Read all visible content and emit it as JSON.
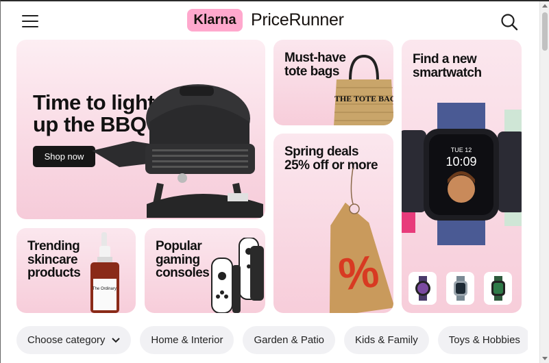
{
  "header": {
    "brand_klarna": "Klarna",
    "brand_name": "PriceRunner",
    "menu_icon": "hamburger-menu-icon",
    "search_icon": "search-icon"
  },
  "cards": {
    "bbq": {
      "title_line1": "Time to light",
      "title_line2": "up the BBQ",
      "button": "Shop now"
    },
    "tote": {
      "title_line1": "Must-have",
      "title_line2": "tote bags",
      "product_text": "THE TOTE BAG"
    },
    "watch": {
      "title_line1": "Find a new",
      "title_line2": "smartwatch",
      "time": "10:09",
      "date": "TUE 12"
    },
    "spring": {
      "title_line1": "Spring deals",
      "title_line2": "25% off or more",
      "tag_symbol": "%"
    },
    "skincare": {
      "title_line1": "Trending",
      "title_line2": "skincare",
      "title_line3": "products",
      "product_text": "The Ordinary."
    },
    "gaming": {
      "title_line1": "Popular",
      "title_line2": "gaming",
      "title_line3": "consoles"
    }
  },
  "categories": {
    "choose": "Choose category",
    "items": [
      "Home & Interior",
      "Garden & Patio",
      "Kids & Family",
      "Toys & Hobbies"
    ]
  },
  "colors": {
    "brand_pink": "#ffa8cd",
    "card_pink": "#f7cdda",
    "button_dark": "#171717"
  }
}
